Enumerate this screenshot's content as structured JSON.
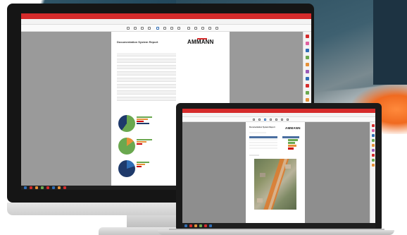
{
  "monitor": {
    "window_title": "",
    "tabs": [
      "",
      "",
      "",
      ""
    ],
    "report": {
      "brand": "AMMANN",
      "title": "Documentation System Report",
      "subtitle": "",
      "info_rows": [
        "",
        "",
        "",
        "",
        "",
        "",
        "",
        "",
        "",
        "",
        "",
        "",
        "",
        "",
        ""
      ]
    }
  },
  "laptop": {
    "window_title": "",
    "tabs": [
      "",
      "",
      ""
    ],
    "report": {
      "brand": "AMMANN",
      "title": "Documentation System Report"
    }
  },
  "colors": {
    "accent_red": "#d52b2b",
    "pie_navy": "#1f3a6b",
    "pie_green": "#6aa84f",
    "pie_blue": "#2f6db5",
    "legend_orange": "#e69138",
    "legend_red": "#cc0000",
    "map_route": "#e07a2c"
  }
}
